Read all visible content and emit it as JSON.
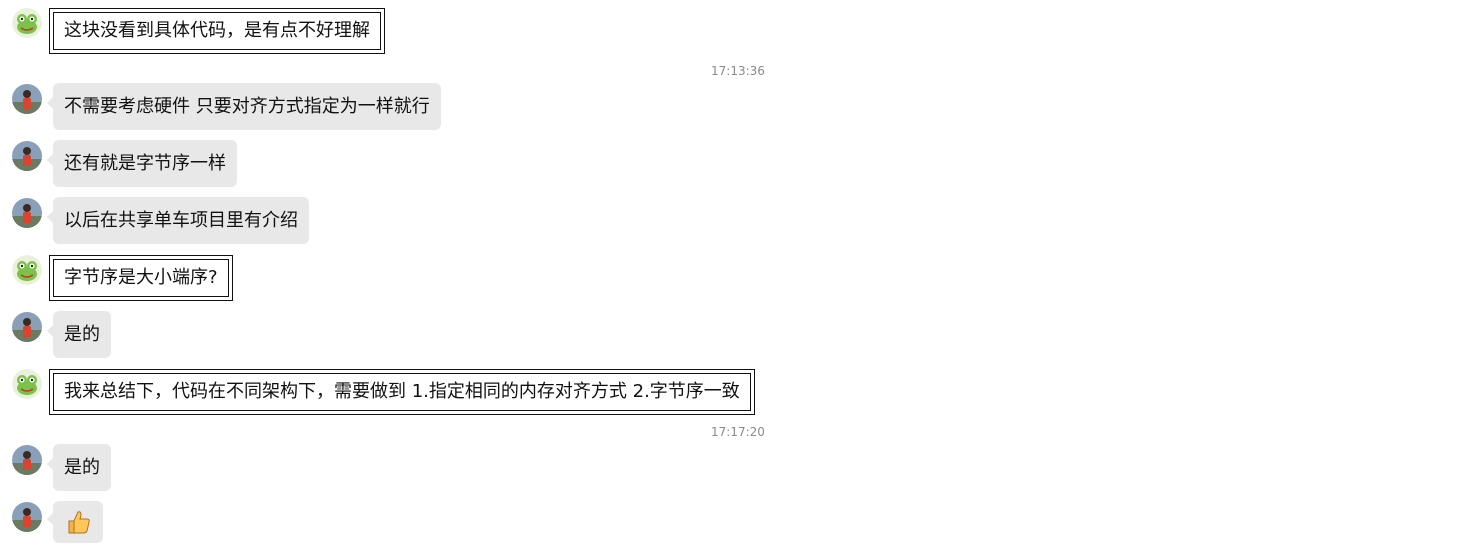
{
  "colors": {
    "gray_bubble": "#e8e8e8",
    "timestamp": "#8a8a8a",
    "text": "#111111"
  },
  "messages": [
    {
      "sender": "frog",
      "style": "framed",
      "text": "这块没看到具体代码，是有点不好理解"
    },
    {
      "sender": "photo",
      "style": "gray",
      "text": "不需要考虑硬件  只要对齐方式指定为一样就行"
    },
    {
      "sender": "photo",
      "style": "gray",
      "text": "还有就是字节序一样"
    },
    {
      "sender": "photo",
      "style": "gray",
      "text": "以后在共享单车项目里有介绍"
    },
    {
      "sender": "frog",
      "style": "framed",
      "text": "字节序是大小端序?"
    },
    {
      "sender": "photo",
      "style": "gray",
      "text": "是的"
    },
    {
      "sender": "frog",
      "style": "framed",
      "text": "我来总结下，代码在不同架构下，需要做到   1.指定相同的内存对齐方式   2.字节序一致"
    },
    {
      "sender": "photo",
      "style": "gray",
      "text": "是的"
    },
    {
      "sender": "photo",
      "style": "emoji",
      "icon": "thumbs-up-icon"
    }
  ],
  "timestamps": [
    "17:13:36",
    "17:17:20"
  ]
}
